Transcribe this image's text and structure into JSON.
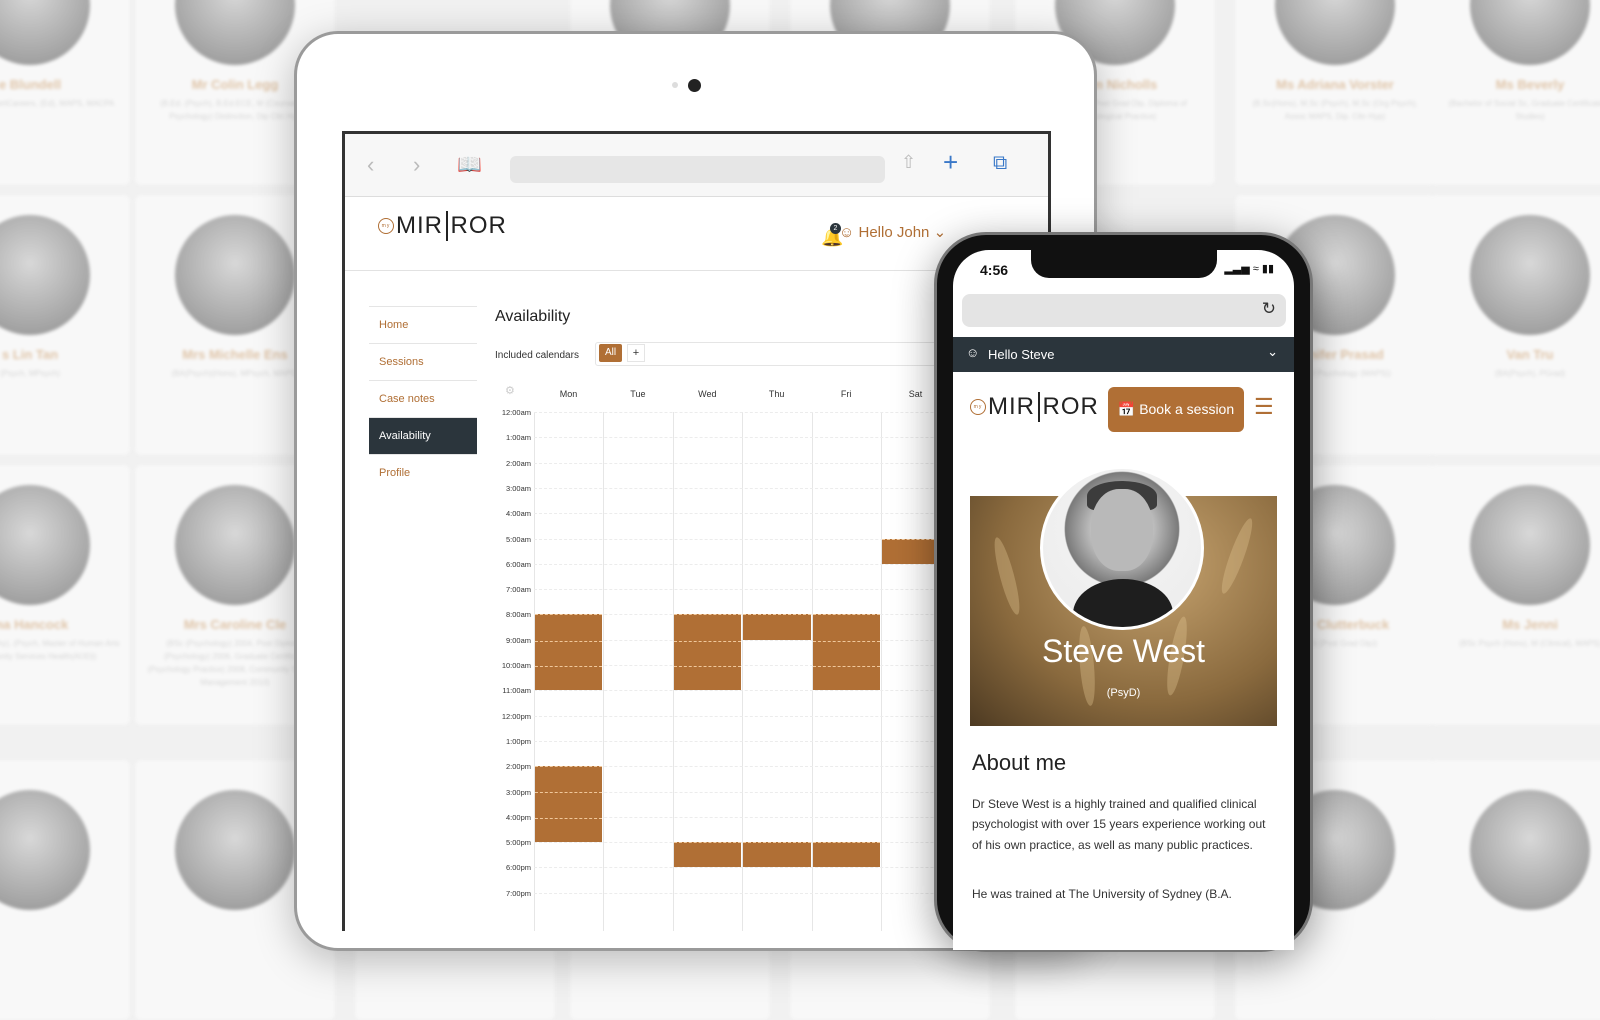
{
  "background_cards": [
    {
      "name": "e Blundell",
      "credentials": "(Hons), GradCertCareers, (Ed), MAPS, MACPA"
    },
    {
      "name": "Mr Colin Legg",
      "credentials": "(B.Ed. (Psych), B.Ed.ECE, M (Counselling Psychology) Distinction, Dip Clin Hyp"
    },
    {
      "name": "",
      "credentials": ""
    },
    {
      "name": "",
      "credentials": ""
    },
    {
      "name": "Liam Nicholls",
      "credentials": "(Psychology), Post Grad Dip, Diploma of Psychological Practice)"
    },
    {
      "name": "Ms Adriana Vorster",
      "credentials": "(B.Sc(Hons), M.Sc (Psych), M.Sc (Org Psych), Assoc MAPS, Dip. Clin Hyp)"
    },
    {
      "name": "Ms Beverly",
      "credentials": "(Bachelor of Social Sc, Graduate Certificate in Studies)"
    },
    {
      "name": "s Lin Tan",
      "credentials": "(Psych, MPsych)"
    },
    {
      "name": "Mrs Michelle Ens",
      "credentials": "(BA(Psych)(Hons), MPsych, MAPS)"
    },
    {
      "name": "Jennifer Prasad",
      "credentials": "(Master of Psychology (MAPS))"
    },
    {
      "name": "Van Tru",
      "credentials": "(BA(Psych), PGrad)"
    },
    {
      "name": "ma Hancock",
      "credentials": "(Psych/Philosophy), (Psych, Master of Human Arts of Community Services Health(AOD))"
    },
    {
      "name": "Mrs Caroline Cle",
      "credentials": "(BSc (Psychology) 2004, Post Diploma (Psychology) 2006, Graduate Certificate (Psychology Practice) 2008, Community Services Management 2010)"
    },
    {
      "name": "Carly Clutterbuck",
      "credentials": "(Psych (Post Grad Dip))"
    },
    {
      "name": "Ms Jenni",
      "credentials": "(BSc Psych (Hons), M (Clinical), MAPS)"
    }
  ],
  "tablet": {
    "brand": {
      "my": "my",
      "left": "MIR",
      "right": "ROR"
    },
    "notifications_count": "2",
    "greeting": "Hello John",
    "sidebar": [
      {
        "label": "Home"
      },
      {
        "label": "Sessions"
      },
      {
        "label": "Case notes"
      },
      {
        "label": "Availability",
        "active": true
      },
      {
        "label": "Profile"
      }
    ],
    "page_title": "Availability",
    "included_calendars_label": "Included calendars",
    "calendar_chip": "All",
    "add_calendar": "+",
    "days": [
      "Mon",
      "Tue",
      "Wed",
      "Thu",
      "Fri",
      "Sat"
    ],
    "times": [
      "12:00am",
      "1:00am",
      "2:00am",
      "3:00am",
      "4:00am",
      "5:00am",
      "6:00am",
      "7:00am",
      "8:00am",
      "9:00am",
      "10:00am",
      "11:00am",
      "12:00pm",
      "1:00pm",
      "2:00pm",
      "3:00pm",
      "4:00pm",
      "5:00pm",
      "6:00pm",
      "7:00pm"
    ],
    "availability": [
      {
        "day": "Mon",
        "start": 8,
        "end": 11
      },
      {
        "day": "Mon",
        "start": 14,
        "end": 17
      },
      {
        "day": "Wed",
        "start": 8,
        "end": 11
      },
      {
        "day": "Wed",
        "start": 17,
        "end": 18
      },
      {
        "day": "Thu",
        "start": 8,
        "end": 9
      },
      {
        "day": "Thu",
        "start": 17,
        "end": 18
      },
      {
        "day": "Fri",
        "start": 8,
        "end": 11
      },
      {
        "day": "Fri",
        "start": 17,
        "end": 18
      },
      {
        "day": "Sat",
        "start": 5,
        "end": 6
      }
    ]
  },
  "phone": {
    "time": "4:56",
    "greeting": "Hello Steve",
    "book_label": "Book a session",
    "profile_name": "Steve West",
    "profile_degree": "(PsyD)",
    "about_title": "About me",
    "paragraphs": [
      "Dr Steve West is a highly trained and qualified clinical psychologist with over 15 years experience working out of his own practice, as well as many public practices.",
      "He was trained at The University of Sydney (B.A."
    ]
  },
  "colors": {
    "brand": "#b06f35",
    "dark": "#2b353c"
  }
}
